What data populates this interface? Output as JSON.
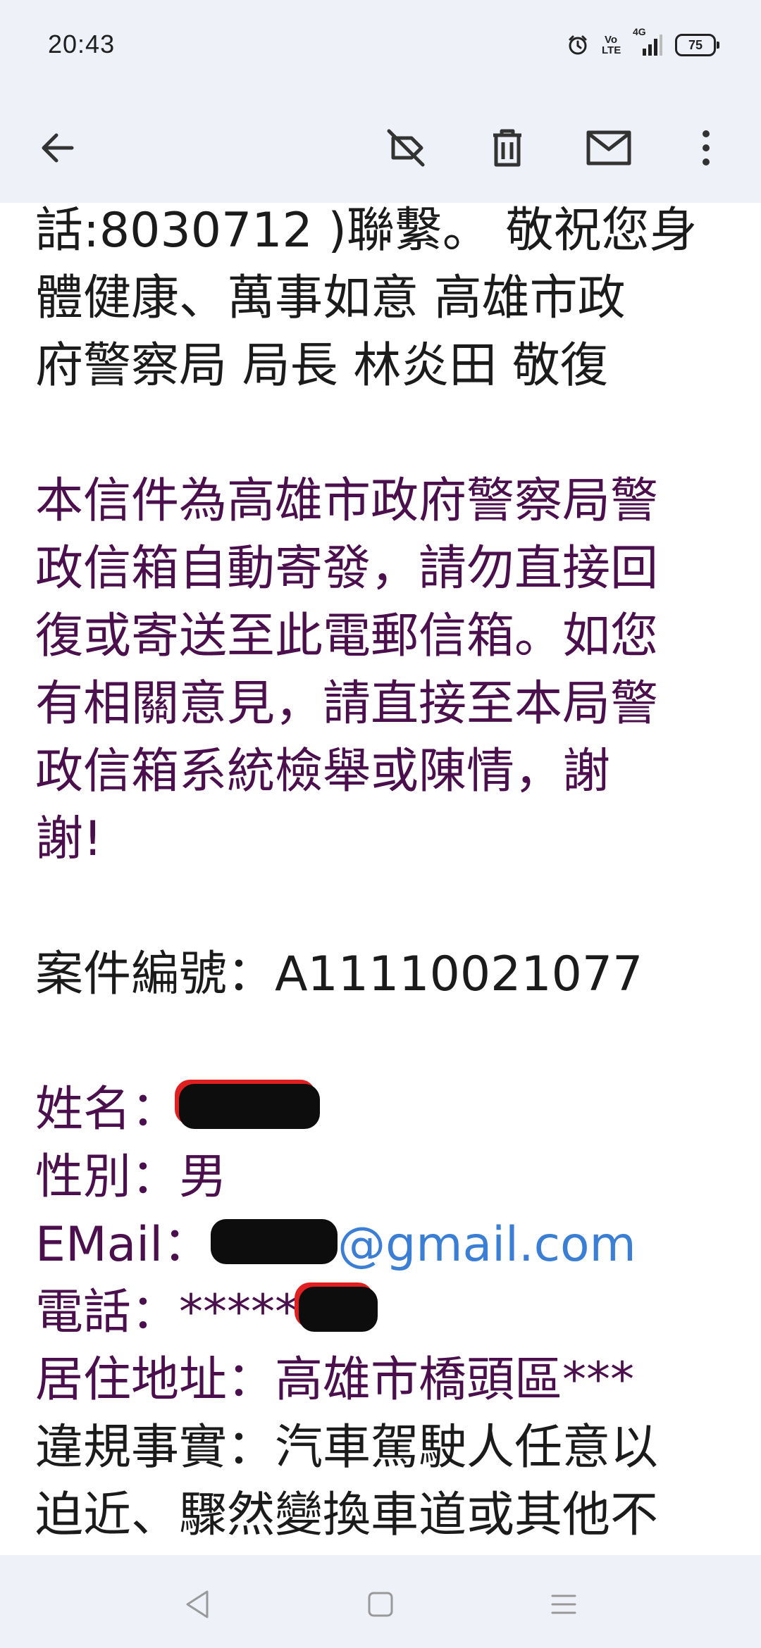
{
  "status": {
    "time": "20:43",
    "network_label": "Vo LTE",
    "signal_label": "4G",
    "battery": "75",
    "icons": [
      "alarm-icon",
      "volte-icon",
      "signal-icon",
      "battery-icon"
    ]
  },
  "toolbar": {
    "icons": [
      "back-arrow-icon",
      "label-off-icon",
      "delete-icon",
      "mail-icon",
      "more-vert-icon"
    ]
  },
  "email": {
    "para1": [
      "話:8030712 )聯繫。 敬祝您身",
      "體健康、萬事如意 高雄市政",
      "府警察局 局長 林炎田 敬復"
    ],
    "notice": [
      "本信件為高雄市政府警察局警",
      "政信箱自動寄發，請勿直接回",
      "復或寄送至此電郵信箱。如您",
      "有相關意見，請直接至本局警",
      "政信箱系統檢舉或陳情，謝",
      "謝!"
    ],
    "case_label": "案件編號：A11110021077",
    "name_label": "姓名：",
    "gender_label": "性別：男",
    "email_label": "EMail：",
    "email_domain": "@gmail.com",
    "phone_label": "電話：*****",
    "address_label": "居住地址：高雄市橋頭區***",
    "violation_lines": [
      "違規事實：汽車駕駛人任意以",
      "迫近、驟然變換車道或其他不"
    ]
  },
  "colors": {
    "bar_bg": "#eef1f8",
    "text_black": "#1b1b1b",
    "text_purple": "#4c0f4d",
    "link_blue": "#3a7fd5",
    "redaction_red": "#e02020"
  }
}
